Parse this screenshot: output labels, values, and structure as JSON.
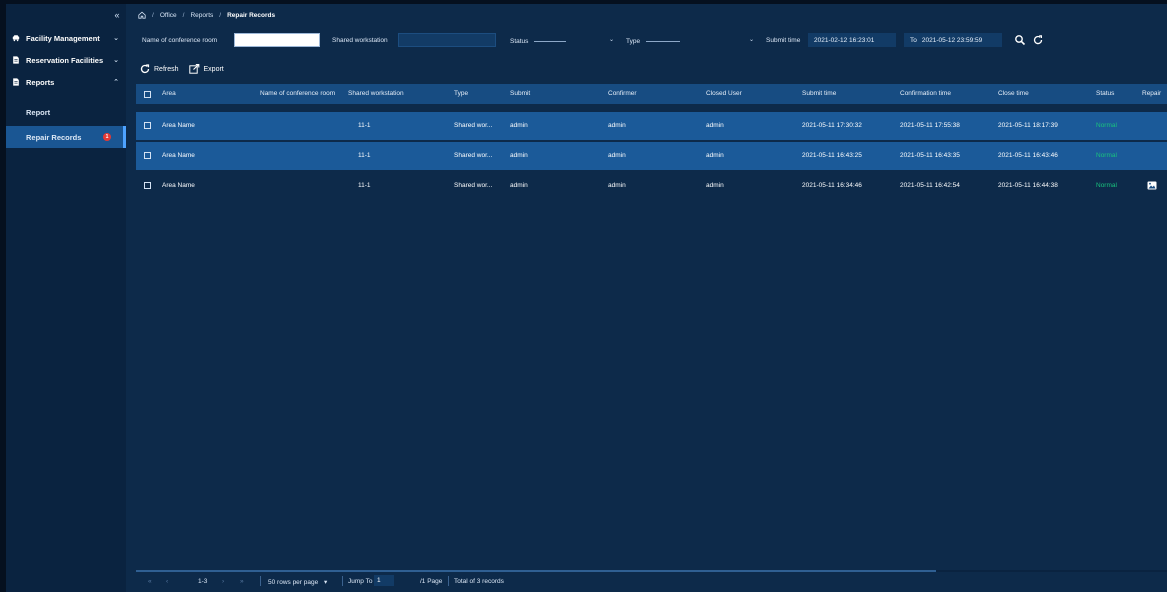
{
  "sidebar": {
    "collapse_icon": "double-chevron-left-icon",
    "items": [
      {
        "label": "Facility Management",
        "icon": "car-icon"
      },
      {
        "label": "Reservation Facilities",
        "icon": "document-icon"
      },
      {
        "label": "Reports",
        "icon": "document-icon"
      }
    ],
    "subitems": [
      {
        "label": "Report"
      },
      {
        "label": "Repair Records",
        "badge": "1"
      }
    ]
  },
  "breadcrumb": {
    "home_icon": "home-icon",
    "items": [
      "Office",
      "Reports",
      "Repair Records"
    ]
  },
  "filters": {
    "conference_room_label": "Name of conference room",
    "conference_room_value": "",
    "shared_workstation_label": "Shared workstation",
    "shared_workstation_value": "",
    "status_label": "Status",
    "type_label": "Type",
    "submit_time_label": "Submit time",
    "date_from": "2021-02-12 16:23:01",
    "date_to_label": "To",
    "date_to": "2021-05-12 23:59:59"
  },
  "toolbar": {
    "refresh_label": "Refresh",
    "export_label": "Export"
  },
  "table": {
    "columns": [
      "Area",
      "Name of conference room",
      "Shared workstation",
      "Type",
      "Submit",
      "Confirmer",
      "Closed User",
      "Submit time",
      "Confirmation time",
      "Close time",
      "Status",
      "Repair"
    ],
    "rows": [
      {
        "area": "Area Name",
        "room": "",
        "workstation": "11-1",
        "type": "Shared wor...",
        "submit": "admin",
        "confirmer": "admin",
        "closed_user": "admin",
        "submit_time": "2021-05-11 17:30:32",
        "confirmation_time": "2021-05-11 17:55:38",
        "close_time": "2021-05-11 18:17:39",
        "status": "Normal"
      },
      {
        "area": "Area Name",
        "room": "",
        "workstation": "11-1",
        "type": "Shared wor...",
        "submit": "admin",
        "confirmer": "admin",
        "closed_user": "admin",
        "submit_time": "2021-05-11 16:43:25",
        "confirmation_time": "2021-05-11 16:43:35",
        "close_time": "2021-05-11 16:43:46",
        "status": "Normal"
      },
      {
        "area": "Area Name",
        "room": "",
        "workstation": "11-1",
        "type": "Shared wor...",
        "submit": "admin",
        "confirmer": "admin",
        "closed_user": "admin",
        "submit_time": "2021-05-11 16:34:46",
        "confirmation_time": "2021-05-11 16:42:54",
        "close_time": "2021-05-11 16:44:38",
        "status": "Normal",
        "repair_icon": "image-icon"
      }
    ]
  },
  "footer": {
    "page_range": "1-3",
    "rows_per_page": "50 rows per page",
    "jump_to_label": "Jump To",
    "jump_to_value": "1",
    "page_count": "/1 Page",
    "total": "Total of 3 records"
  },
  "colors": {
    "background": "#0d2a4a",
    "sidebar": "#0a2340",
    "header_row": "#174c82",
    "selected_row": "#1b5a99",
    "status_normal": "#19c37d",
    "badge": "#e53935"
  }
}
